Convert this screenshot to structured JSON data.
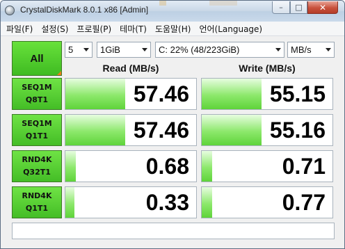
{
  "window": {
    "title": "CrystalDiskMark 8.0.1 x86 [Admin]",
    "min_glyph": "–",
    "max_glyph": "□",
    "close_glyph": "✕"
  },
  "menu": [
    {
      "label": "파일(F)"
    },
    {
      "label": "설정(S)"
    },
    {
      "label": "프로필(P)"
    },
    {
      "label": "테마(T)"
    },
    {
      "label": "도움말(H)"
    },
    {
      "label": "언어(Language)"
    }
  ],
  "controls": {
    "all_label": "All",
    "count": "5",
    "size": "1GiB",
    "drive": "C: 22% (48/223GiB)",
    "unit": "MB/s"
  },
  "headers": {
    "read": "Read (MB/s)",
    "write": "Write (MB/s)"
  },
  "tests": [
    {
      "line1": "SEQ1M",
      "line2": "Q8T1",
      "read": "57.46",
      "write": "55.15",
      "read_fill": 0.46,
      "write_fill": 0.46
    },
    {
      "line1": "SEQ1M",
      "line2": "Q1T1",
      "read": "57.46",
      "write": "55.16",
      "read_fill": 0.46,
      "write_fill": 0.46
    },
    {
      "line1": "RND4K",
      "line2": "Q32T1",
      "read": "0.68",
      "write": "0.71",
      "read_fill": 0.08,
      "write_fill": 0.08
    },
    {
      "line1": "RND4K",
      "line2": "Q1T1",
      "read": "0.33",
      "write": "0.77",
      "read_fill": 0.07,
      "write_fill": 0.08
    }
  ],
  "colors": {
    "accent_green": "#44bd26",
    "close_red": "#c8513c"
  }
}
